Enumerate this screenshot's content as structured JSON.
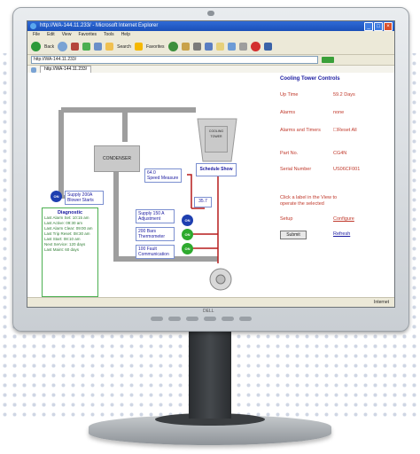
{
  "window": {
    "title": "http://WA-144.11.233/ - Microsoft Internet Explorer"
  },
  "menu": [
    "File",
    "Edit",
    "View",
    "Favorites",
    "Tools",
    "Help"
  ],
  "toolbar": {
    "back_label": "Back",
    "search_label": "Search",
    "favorites_label": "Favorites"
  },
  "address": {
    "value": "http://WA-144.11.233/",
    "tab_label": "http://WA-144.11.233/"
  },
  "diagram": {
    "condenser_label": "CONDENSER",
    "cooling_tower_label": "COOLING TOWER",
    "schedule_label": "Schedule Show",
    "valve1": "Supply 200A\nBlower Starts",
    "valve2": "64.0\nSpeed Measure",
    "temp_box": "35.7",
    "pump_box1": "Supply 150 A\nAdjustment",
    "pump_box2": "200 Bars\nThermometer",
    "pump_box3": "100 Fault\nCommunication",
    "circle_labels": [
      "ON",
      "ON",
      "ON",
      "ON"
    ],
    "diagnostics_title": "Diagnostic",
    "diagnostics_lines": [
      "Last Alarm Set: 10:15 am",
      "Last Active: 09:30 am",
      "Last Alarm Clear: 09:00 am",
      "Last Trip Reset: 08:30 am",
      "Last Start: 08:10 am",
      "Next Service: 120 days",
      "Last Maint: 60 days"
    ]
  },
  "controls": {
    "header": "Cooling Tower Controls",
    "rows": [
      {
        "k": "Up Time",
        "v": "59.2 Days"
      },
      {
        "k": "Alarms",
        "v": "none"
      },
      {
        "k": "Alarms and Timers",
        "v": "Reset All"
      },
      {
        "k": "Part No.",
        "v": "CG4N"
      },
      {
        "k": "Serial Number",
        "v": "US06CF001"
      }
    ],
    "note": "Click a label in the View to operate the selected",
    "setup_label": "Setup",
    "configure_link": "Configure",
    "submit_label": "Submit",
    "refresh_link": "Refresh"
  },
  "status": {
    "zone": "Internet"
  },
  "monitor": {
    "brand": "DELL"
  }
}
